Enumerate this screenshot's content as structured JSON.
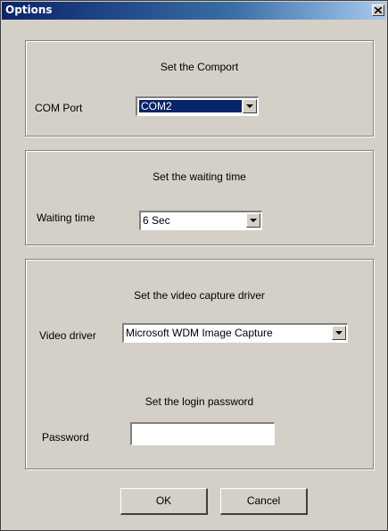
{
  "window": {
    "title": "Options"
  },
  "comport": {
    "caption": "Set the Comport",
    "label": "COM Port",
    "value": "COM2"
  },
  "waiting": {
    "caption": "Set the waiting time",
    "label": "Waiting time",
    "value": "6 Sec"
  },
  "video": {
    "caption": "Set the video capture driver",
    "label": "Video driver",
    "value": "Microsoft WDM Image Capture"
  },
  "login": {
    "caption": "Set the login password",
    "label": "Password",
    "value": ""
  },
  "buttons": {
    "ok": "OK",
    "cancel": "Cancel"
  }
}
